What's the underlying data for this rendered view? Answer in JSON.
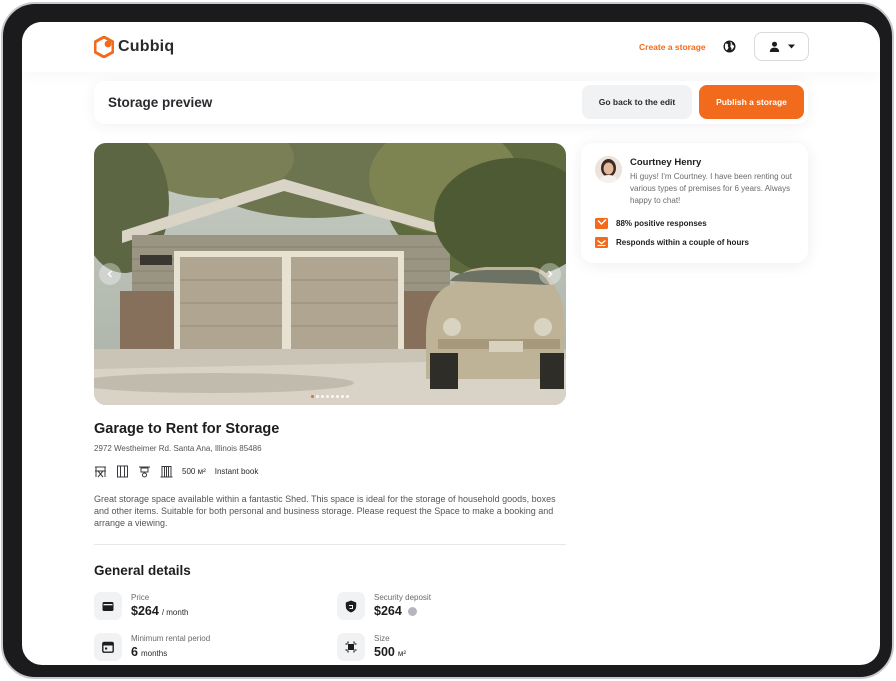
{
  "app": {
    "name": "Cubbiq"
  },
  "header": {
    "create_link": "Create a storage"
  },
  "preview_bar": {
    "title": "Storage preview",
    "back_label": "Go back to the edit",
    "publish_label": "Publish a storage"
  },
  "gallery": {
    "image_count": 8,
    "active_index": 0
  },
  "listing": {
    "title": "Garage to Rent for Storage",
    "address": "2972 Westheimer Rd. Santa Ana, Illinois 85486",
    "area": "500 м²",
    "instant_book": "Instant book",
    "description": "Great storage space available within a fantastic Shed. This space is ideal for the storage of household goods, boxes and other items. Suitable for both personal and business storage. Please request the Space to make a booking and arrange a viewing."
  },
  "general_details": {
    "heading": "General details",
    "price": {
      "label": "Price",
      "value": "$264",
      "unit": "/ month"
    },
    "deposit": {
      "label": "Security deposit",
      "value": "$264"
    },
    "min_period": {
      "label": "Minimum rental period",
      "value": "6",
      "unit": "months"
    },
    "size": {
      "label": "Size",
      "value": "500",
      "unit": "м²"
    }
  },
  "host": {
    "name": "Courtney Henry",
    "bio": "Hi guys! I'm Courtney. I have been renting out various types of premises for 6 years. Always happy to chat!",
    "positive_responses": "88% positive responses",
    "response_time": "Responds within a couple of hours"
  },
  "colors": {
    "accent": "#f26a1b",
    "text": "#1d1d1f",
    "muted": "#6b6b70"
  }
}
